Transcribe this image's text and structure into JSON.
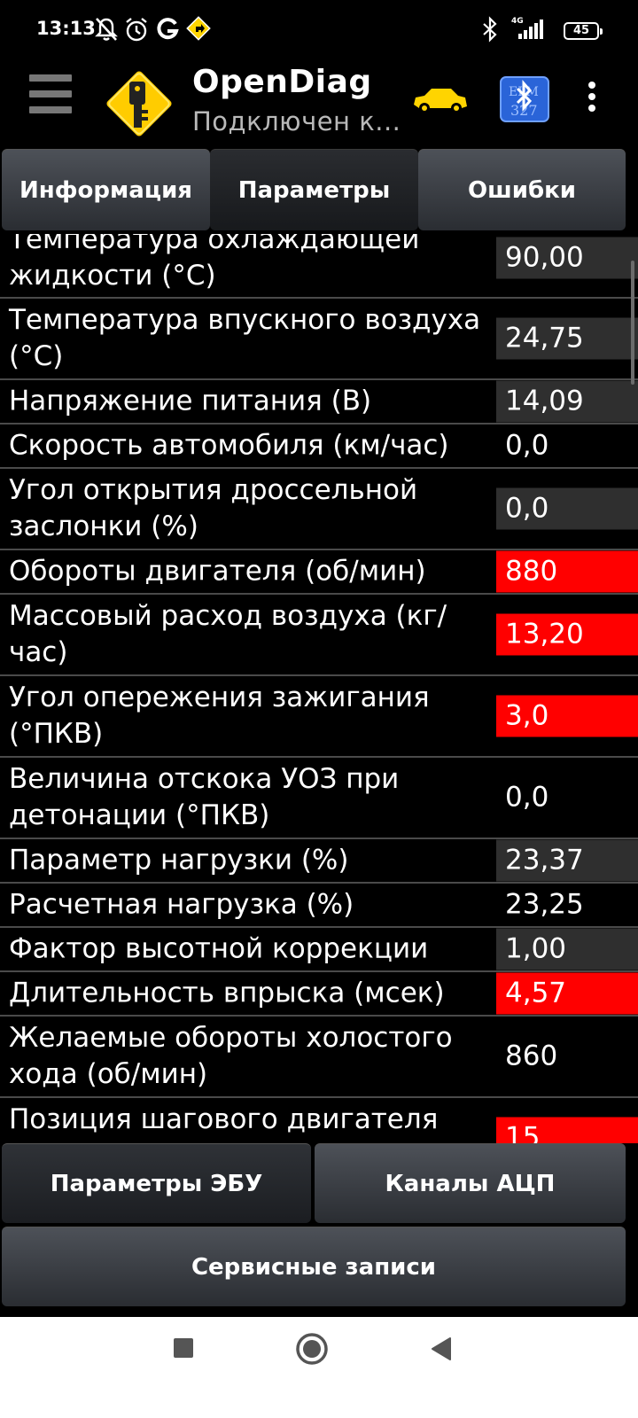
{
  "status_bar": {
    "time": "13:13",
    "battery": "45",
    "network": "4G",
    "left_icons": [
      "mute-bell-icon",
      "alarm-icon",
      "google-icon",
      "navigation-app-icon"
    ],
    "right_icons": [
      "bluetooth-icon",
      "signal-icon",
      "battery-icon"
    ]
  },
  "app_bar": {
    "title": "OpenDiag",
    "subtitle": "Подключен к...",
    "icons": [
      "menu-icon",
      "app-logo-key-icon",
      "car-icon",
      "bluetooth-adapter-icon",
      "more-icon"
    ],
    "accent_color": "#ffd400"
  },
  "tabs": [
    {
      "label": "Информация",
      "active": false
    },
    {
      "label": "Параметры",
      "active": true
    },
    {
      "label": "Ошибки",
      "active": false
    }
  ],
  "parameters": [
    {
      "name": "Температура охлаждающей жидкости (°C)",
      "value": "90,00",
      "highlight": "gray"
    },
    {
      "name": "Температура впускного воздуха (°C)",
      "value": "24,75",
      "highlight": "gray"
    },
    {
      "name": "Напряжение питания (В)",
      "value": "14,09",
      "highlight": "gray"
    },
    {
      "name": "Скорость автомобиля (км/час)",
      "value": "0,0",
      "highlight": "none"
    },
    {
      "name": "Угол открытия дроссельной заслонки (%)",
      "value": "0,0",
      "highlight": "gray"
    },
    {
      "name": "Обороты двигателя (об/мин)",
      "value": "880",
      "highlight": "red"
    },
    {
      "name": "Массовый расход воздуха (кг/час)",
      "value": "13,20",
      "highlight": "red"
    },
    {
      "name": "Угол опережения зажигания (°ПКВ)",
      "value": "3,0",
      "highlight": "red"
    },
    {
      "name": "Величина отскока УОЗ при детонации (°ПКВ)",
      "value": "0,0",
      "highlight": "none"
    },
    {
      "name": "Параметр нагрузки (%)",
      "value": "23,37",
      "highlight": "gray"
    },
    {
      "name": "Расчетная нагрузка (%)",
      "value": "23,25",
      "highlight": "none"
    },
    {
      "name": "Фактор высотной коррекции",
      "value": "1,00",
      "highlight": "gray"
    },
    {
      "name": "Длительность впрыска (мсек)",
      "value": "4,57",
      "highlight": "red"
    },
    {
      "name": "Желаемые обороты холостого хода (об/мин)",
      "value": "860",
      "highlight": "none"
    },
    {
      "name": "Позиция шагового двигателя (шаг)",
      "value": "15",
      "highlight": "red"
    }
  ],
  "bottom_buttons": {
    "ecu_params": "Параметры ЭБУ",
    "adc_channels": "Каналы АЦП",
    "service_records": "Сервисные записи"
  },
  "nav_bar": {
    "icons": [
      "recents-square-icon",
      "home-circle-icon",
      "back-triangle-icon"
    ]
  },
  "colors": {
    "highlight_red": "#ff0000",
    "highlight_gray": "#2f2f2f",
    "background": "#000000"
  }
}
